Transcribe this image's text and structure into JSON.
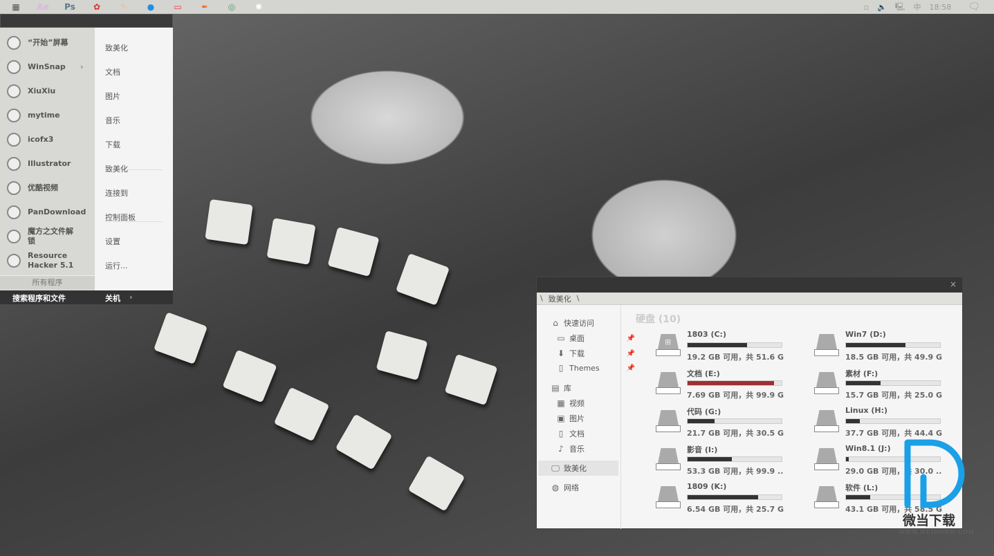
{
  "taskbar": {
    "apps": [
      {
        "icon": "start-grid-icon",
        "glyph": "▦",
        "color": "#555"
      },
      {
        "icon": "after-effects-icon",
        "glyph": "Ae",
        "color": "#d8b8e0"
      },
      {
        "icon": "photoshop-icon",
        "glyph": "Ps",
        "color": "#5a7a90"
      },
      {
        "icon": "gear-red-icon",
        "glyph": "✿",
        "color": "#d83030"
      },
      {
        "icon": "feather-icon",
        "glyph": "✎",
        "color": "#f0c090"
      },
      {
        "icon": "drop-icon",
        "glyph": "●",
        "color": "#1e90e0"
      },
      {
        "icon": "monitor-icon",
        "glyph": "▭",
        "color": "#e04040"
      },
      {
        "icon": "pen-icon",
        "glyph": "✒",
        "color": "#e07020"
      },
      {
        "icon": "chrome-icon",
        "glyph": "◎",
        "color": "#5a9a70"
      },
      {
        "icon": "settings-icon",
        "glyph": "✺",
        "color": "#fff"
      }
    ],
    "tray": {
      "time": "18:58",
      "ime": "中"
    }
  },
  "start_menu": {
    "programs": [
      {
        "label": "“开始”屏幕",
        "icon": "start-screen-icon"
      },
      {
        "label": "WinSnap",
        "icon": "winsnap-icon",
        "arrow": "›"
      },
      {
        "label": "XiuXiu",
        "icon": "xiuxiu-icon"
      },
      {
        "label": "mytime",
        "icon": "mytime-icon"
      },
      {
        "label": "icofx3",
        "icon": "icofx-icon"
      },
      {
        "label": "Illustrator",
        "icon": "illustrator-icon"
      },
      {
        "label": "优酷视频",
        "icon": "youku-icon"
      },
      {
        "label": "PanDownload",
        "icon": "pandownload-icon"
      },
      {
        "label": "魔方之文件解锁",
        "icon": "mofang-icon"
      },
      {
        "label": "Resource Hacker 5.1",
        "icon": "resource-hacker-icon"
      }
    ],
    "all_programs": "所有程序",
    "places": [
      "致美化",
      "文档",
      "图片",
      "音乐",
      "下载",
      "致美化",
      "连接到",
      "控制面板",
      "设置",
      "运行..."
    ],
    "search": "搜索程序和文件",
    "shutdown": "关机",
    "shutdown_arrow": "›"
  },
  "explorer": {
    "breadcrumb": [
      "\\",
      "致美化",
      "\\"
    ],
    "close": "×",
    "sidebar": {
      "quick_access": "快速访问",
      "quick": [
        {
          "label": "桌面",
          "icon": "desktop-icon"
        },
        {
          "label": "下载",
          "icon": "download-icon"
        },
        {
          "label": "Themes",
          "icon": "folder-icon"
        }
      ],
      "library": "库",
      "libs": [
        {
          "label": "视频",
          "icon": "video-icon"
        },
        {
          "label": "图片",
          "icon": "picture-icon"
        },
        {
          "label": "文档",
          "icon": "document-icon"
        },
        {
          "label": "音乐",
          "icon": "music-icon"
        }
      ],
      "this_pc": "致美化",
      "network": "网络"
    },
    "section_title": "硬盘 (10)",
    "drives": [
      {
        "name": "1803 (C:)",
        "info": "19.2 GB 可用，共 51.6 GB",
        "used": 0.63,
        "color": "#333333",
        "windows": true
      },
      {
        "name": "Win7 (D:)",
        "info": "18.5 GB 可用，共 49.9 GB",
        "used": 0.63,
        "color": "#333333"
      },
      {
        "name": "文档 (E:)",
        "info": "7.69 GB 可用，共 99.9 GB",
        "used": 0.92,
        "color": "#a03030"
      },
      {
        "name": "素材 (F:)",
        "info": "15.7 GB 可用，共 25.0 GB",
        "used": 0.37,
        "color": "#333333"
      },
      {
        "name": "代码 (G:)",
        "info": "21.7 GB 可用，共 30.5 GB",
        "used": 0.29,
        "color": "#333333"
      },
      {
        "name": "Linux (H:)",
        "info": "37.7 GB 可用，共 44.4 GB",
        "used": 0.15,
        "color": "#333333"
      },
      {
        "name": "影音 (I:)",
        "info": "53.3 GB 可用，共 99.9 ...",
        "used": 0.47,
        "color": "#333333"
      },
      {
        "name": "Win8.1 (J:)",
        "info": "29.0 GB 可用，共 30.0 ...",
        "used": 0.03,
        "color": "#333333"
      },
      {
        "name": "1809 (K:)",
        "info": "6.54 GB 可用，共 25.7 GB",
        "used": 0.75,
        "color": "#333333"
      },
      {
        "name": "软件 (L:)",
        "info": "43.1 GB 可用，共 58.5 GB",
        "used": 0.26,
        "color": "#333333"
      }
    ]
  },
  "watermark": {
    "brand": "微当下载",
    "url": "WWW.WEIDOWN.COM",
    "color": "#1aa0e6"
  }
}
